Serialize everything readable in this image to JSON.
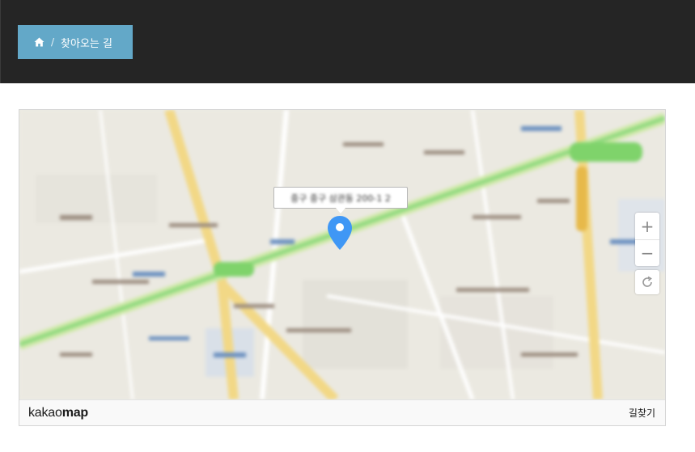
{
  "header": {
    "breadcrumb": {
      "home_icon": "home-icon",
      "separator": "/",
      "current": "찾아오는 길"
    }
  },
  "map": {
    "provider_logo": {
      "light": "kakao",
      "bold": "map"
    },
    "directions_link": "길찾기",
    "zoom_in_label": "+",
    "zoom_out_label": "−",
    "marker_icon": "map-pin-icon",
    "marker_color": "#3f97f5",
    "info_window_text": "중구 중구 삼관동 200-1 2"
  },
  "colors": {
    "topbar": "#252525",
    "breadcrumb_bg": "#63a8c8",
    "subway_line": "#8fd97e",
    "main_road": "#f4d982"
  }
}
